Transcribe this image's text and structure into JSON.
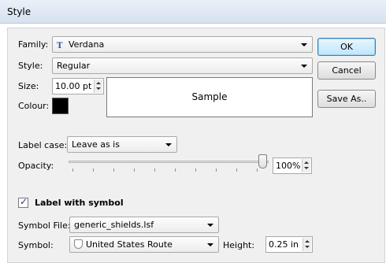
{
  "window": {
    "title": "Style"
  },
  "font": {
    "family_label": "Family:",
    "family_value": "Verdana",
    "family_icon": "truetype-font-icon",
    "style_label": "Style:",
    "style_value": "Regular",
    "size_label": "Size:",
    "size_value": "10.00 pt",
    "colour_label": "Colour:",
    "colour_value": "#000000",
    "sample_text": "Sample"
  },
  "buttons": {
    "ok": "OK",
    "cancel": "Cancel",
    "save_as": "Save As.."
  },
  "label_case": {
    "label": "Label case:",
    "value": "Leave as is"
  },
  "opacity": {
    "label": "Opacity:",
    "value": "100%",
    "level": 100
  },
  "symbol": {
    "checkbox_label": "Label with symbol",
    "checked": true,
    "file_label": "Symbol File:",
    "file_value": "generic_shields.lsf",
    "symbol_label": "Symbol:",
    "symbol_value": "United States Route",
    "symbol_icon": "shield-icon",
    "height_label": "Height:",
    "height_value": "0.25 in"
  }
}
